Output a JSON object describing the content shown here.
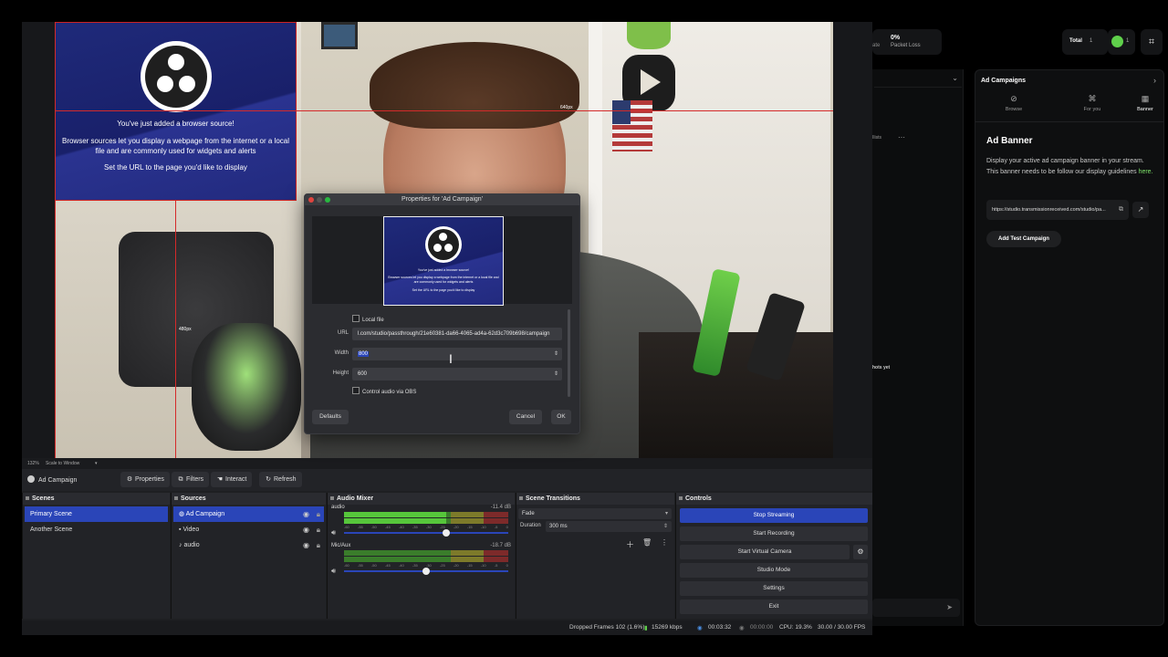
{
  "obs": {
    "preview": {
      "zoom_label": "132%",
      "scale_label": "Scale to Window",
      "px_width_tag": "640px",
      "px_height_tag": "480px",
      "browser_source_card": {
        "title": "You've just added a browser source!",
        "body": "Browser sources let you display a webpage from the internet or a local file and are commonly used for widgets and alerts",
        "footer": "Set the URL to the page you'd like to display"
      }
    },
    "source_toolbar": {
      "current_source": "Ad Campaign",
      "buttons": [
        {
          "label": "Properties",
          "icon": "gear-icon"
        },
        {
          "label": "Filters",
          "icon": "filter-icon"
        },
        {
          "label": "Interact",
          "icon": "hand-icon"
        },
        {
          "label": "Refresh",
          "icon": "refresh-icon"
        }
      ]
    },
    "scenes": {
      "header": "Scenes",
      "items": [
        "Primary Scene",
        "Another Scene"
      ],
      "selected": "Primary Scene"
    },
    "sources": {
      "header": "Sources",
      "items": [
        {
          "label": "Ad Campaign",
          "icon": "globe-icon"
        },
        {
          "label": "Video",
          "icon": "camera-icon"
        },
        {
          "label": "audio",
          "icon": "mic-icon"
        }
      ],
      "selected": "Ad Campaign"
    },
    "mixer": {
      "header": "Audio Mixer",
      "channels": [
        {
          "name": "audio",
          "db": "-11.4 dB",
          "level": 0.62,
          "volume": 0.62
        },
        {
          "name": "Mic/Aux",
          "db": "-18.7 dB",
          "level": 0,
          "volume": 0.5
        }
      ],
      "ticks": [
        "-60",
        "-55",
        "-50",
        "-45",
        "-40",
        "-35",
        "-30",
        "-25",
        "-20",
        "-15",
        "-10",
        "-5",
        "0"
      ]
    },
    "transitions": {
      "header": "Scene Transitions",
      "selected": "Fade",
      "duration_label": "Duration",
      "duration_value": "300 ms"
    },
    "controls": {
      "header": "Controls",
      "buttons": [
        "Stop Streaming",
        "Start Recording",
        "Start Virtual Camera",
        "Studio Mode",
        "Settings",
        "Exit"
      ]
    },
    "status": {
      "dropped_frames": "Dropped Frames 102 (1.6%)",
      "bitrate": "15269 kbps",
      "stream_time": "00:03:32",
      "record_time": "00:00:00",
      "cpu": "CPU: 19.3%",
      "fps": "30.00 / 30.00 FPS"
    }
  },
  "dialog": {
    "title": "Properties for 'Ad Campaign'",
    "preview_card": {
      "title": "You've just added a browser source!",
      "body": "Browser sources let you display a webpage from the internet or a local file and are commonly used for widgets and alerts",
      "footer": "Set the URL to the page you'd like to display"
    },
    "local_file_label": "Local file",
    "url_label": "URL",
    "url_value": "l.com/studio/passthrough/21e60381-da66-4065-ad4a-62d3c709b698/campaign",
    "width_label": "Width",
    "width_value": "800",
    "height_label": "Height",
    "height_value": "600",
    "control_audio_label": "Control audio via OBS",
    "defaults_label": "Defaults",
    "cancel_label": "Cancel",
    "ok_label": "OK"
  },
  "rightapp": {
    "packet_loss_value": "0%",
    "packet_loss_label": "Packet Loss",
    "stat_fragment": "ate",
    "total_label": "Total",
    "total_count": "1",
    "viewer_count": "1",
    "left_col_fragment_1": "Ilists",
    "left_col_fragment_2": "hots yet",
    "panel": {
      "header": "Ad Campaigns",
      "tabs": [
        {
          "label": "Browse",
          "icon": "compass-icon"
        },
        {
          "label": "For you",
          "icon": "tag-icon"
        },
        {
          "label": "Banner",
          "icon": "grid-icon"
        }
      ],
      "active_tab": "Banner",
      "title": "Ad Banner",
      "description": "Display your active ad campaign banner in your stream. This banner needs to be follow our display guidelines",
      "description_link": "here.",
      "url": "https://studio.transmissionreceived.com/studio/pa...",
      "add_button": "Add Test Campaign"
    },
    "colors": {
      "accent_green": "#7ee36a",
      "obs_blue": "#2a45b8"
    }
  }
}
